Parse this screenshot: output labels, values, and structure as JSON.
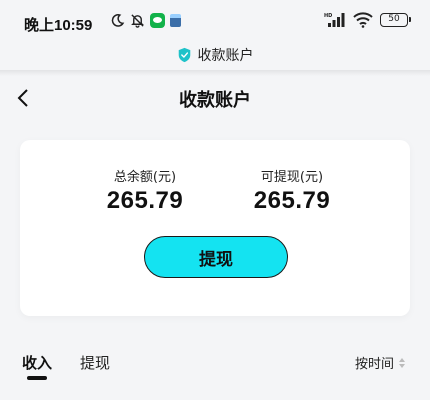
{
  "status_bar": {
    "time": "晚上10:59",
    "battery": "50",
    "hd": "HD"
  },
  "mini_program": {
    "title": "收款账户"
  },
  "nav": {
    "title": "收款账户"
  },
  "balance": {
    "total_label": "总余额(元)",
    "total_value": "265.79",
    "withdrawable_label": "可提现(元)",
    "withdrawable_value": "265.79",
    "withdraw_button": "提现"
  },
  "tabs": {
    "items": [
      {
        "label": "收入",
        "active": true
      },
      {
        "label": "提现",
        "active": false
      }
    ],
    "sort_label": "按时间"
  },
  "colors": {
    "accent": "#14e3f1",
    "background": "#f4f5f7",
    "card": "#ffffff",
    "shield": "#1fc2c9"
  }
}
